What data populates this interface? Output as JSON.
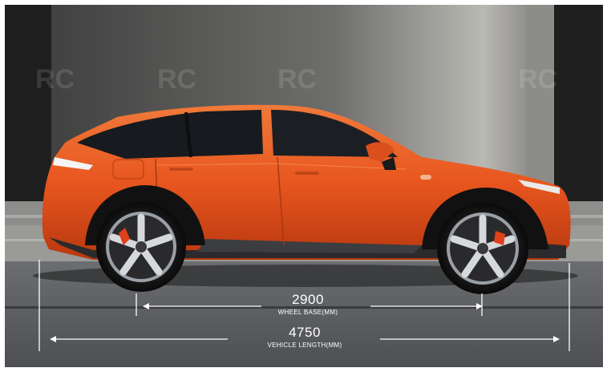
{
  "photo": {
    "subject": "orange-suv-side-view",
    "car_color": "#e8561f",
    "watermark_text": "RC"
  },
  "dimensions": {
    "wheel_base": {
      "value": "2900",
      "caption": "WHEEL BASE(MM)"
    },
    "vehicle_length": {
      "value": "4750",
      "caption": "VEHICLE LENGTH(MM)"
    }
  }
}
